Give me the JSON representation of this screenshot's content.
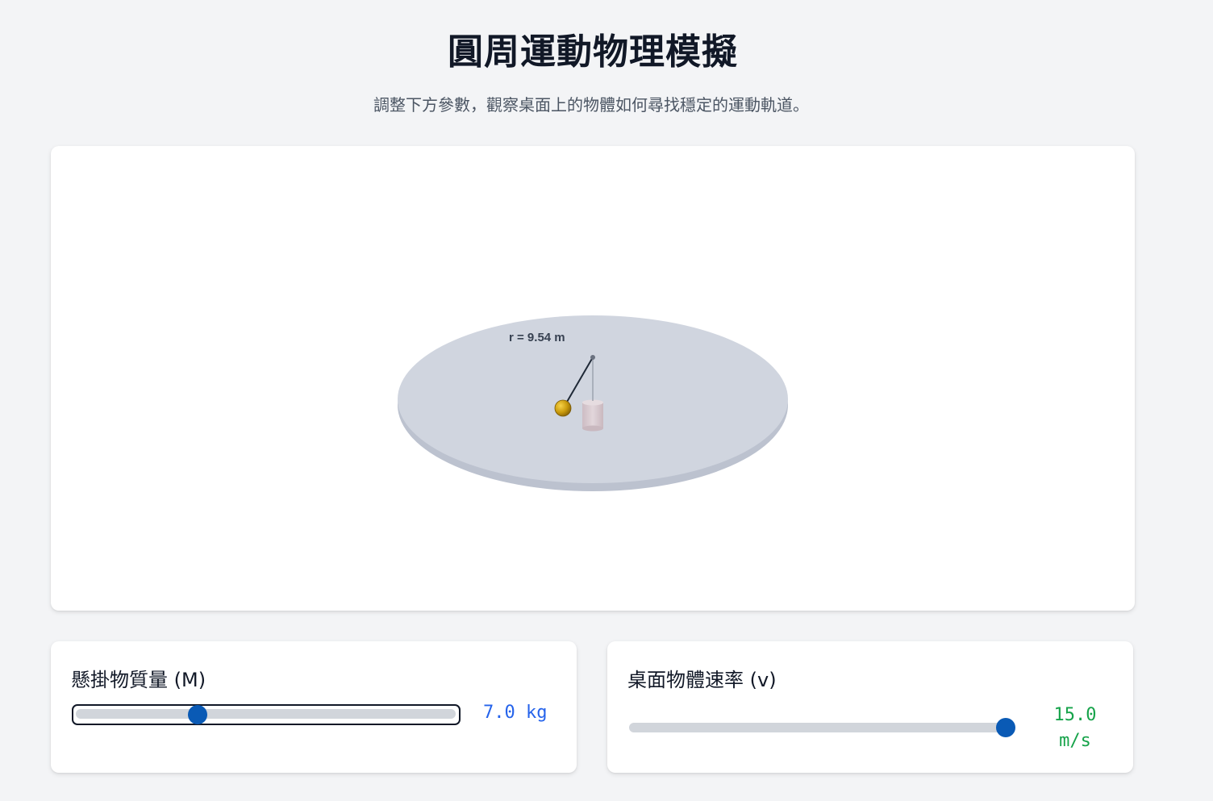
{
  "header": {
    "title": "圓周運動物理模擬",
    "subtitle": "調整下方參數，觀察桌面上的物體如何尋找穩定的運動軌道。"
  },
  "simulation": {
    "radius_label": "r = 9.54 m",
    "colors": {
      "table_top": "#d0d5df",
      "table_edge": "#bcc2cf",
      "ball": "#c99a0c",
      "hanging_mass": "#d8c9cf",
      "string": "#1f2937"
    }
  },
  "controls": {
    "mass": {
      "label": "懸掛物質量 (M)",
      "value_text": "7.0 kg",
      "value": 7.0,
      "fraction": 0.32,
      "thumb_color": "#0a5ab5",
      "value_color": "#2563eb"
    },
    "speed": {
      "label": "桌面物體速率 (v)",
      "value_line1": "15.0",
      "value_line2": "m/s",
      "value": 15.0,
      "fraction": 1.0,
      "thumb_color": "#0a5ab5",
      "value_color": "#16a34a"
    }
  }
}
